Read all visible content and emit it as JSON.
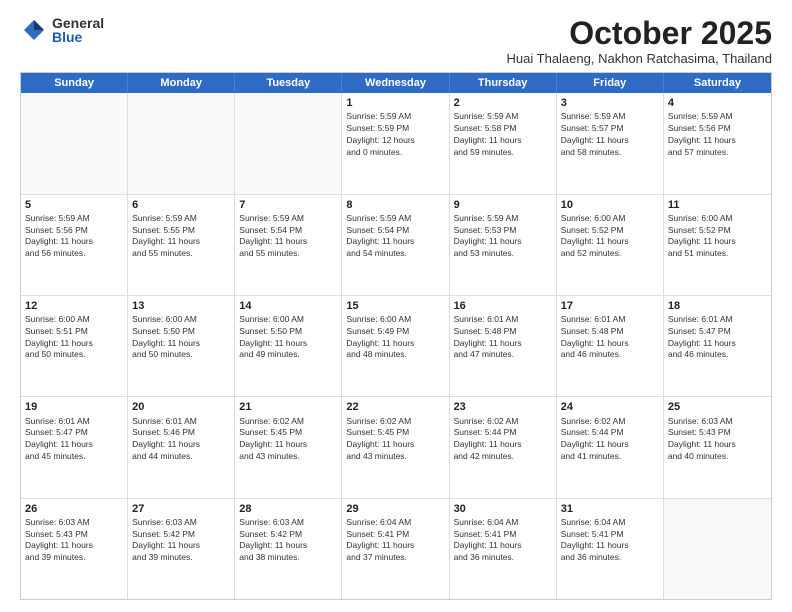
{
  "logo": {
    "general": "General",
    "blue": "Blue"
  },
  "header": {
    "month": "October 2025",
    "location": "Huai Thalaeng, Nakhon Ratchasima, Thailand"
  },
  "days": [
    "Sunday",
    "Monday",
    "Tuesday",
    "Wednesday",
    "Thursday",
    "Friday",
    "Saturday"
  ],
  "weeks": [
    [
      {
        "day": "",
        "text": ""
      },
      {
        "day": "",
        "text": ""
      },
      {
        "day": "",
        "text": ""
      },
      {
        "day": "1",
        "text": "Sunrise: 5:59 AM\nSunset: 5:59 PM\nDaylight: 12 hours\nand 0 minutes."
      },
      {
        "day": "2",
        "text": "Sunrise: 5:59 AM\nSunset: 5:58 PM\nDaylight: 11 hours\nand 59 minutes."
      },
      {
        "day": "3",
        "text": "Sunrise: 5:59 AM\nSunset: 5:57 PM\nDaylight: 11 hours\nand 58 minutes."
      },
      {
        "day": "4",
        "text": "Sunrise: 5:59 AM\nSunset: 5:56 PM\nDaylight: 11 hours\nand 57 minutes."
      }
    ],
    [
      {
        "day": "5",
        "text": "Sunrise: 5:59 AM\nSunset: 5:56 PM\nDaylight: 11 hours\nand 56 minutes."
      },
      {
        "day": "6",
        "text": "Sunrise: 5:59 AM\nSunset: 5:55 PM\nDaylight: 11 hours\nand 55 minutes."
      },
      {
        "day": "7",
        "text": "Sunrise: 5:59 AM\nSunset: 5:54 PM\nDaylight: 11 hours\nand 55 minutes."
      },
      {
        "day": "8",
        "text": "Sunrise: 5:59 AM\nSunset: 5:54 PM\nDaylight: 11 hours\nand 54 minutes."
      },
      {
        "day": "9",
        "text": "Sunrise: 5:59 AM\nSunset: 5:53 PM\nDaylight: 11 hours\nand 53 minutes."
      },
      {
        "day": "10",
        "text": "Sunrise: 6:00 AM\nSunset: 5:52 PM\nDaylight: 11 hours\nand 52 minutes."
      },
      {
        "day": "11",
        "text": "Sunrise: 6:00 AM\nSunset: 5:52 PM\nDaylight: 11 hours\nand 51 minutes."
      }
    ],
    [
      {
        "day": "12",
        "text": "Sunrise: 6:00 AM\nSunset: 5:51 PM\nDaylight: 11 hours\nand 50 minutes."
      },
      {
        "day": "13",
        "text": "Sunrise: 6:00 AM\nSunset: 5:50 PM\nDaylight: 11 hours\nand 50 minutes."
      },
      {
        "day": "14",
        "text": "Sunrise: 6:00 AM\nSunset: 5:50 PM\nDaylight: 11 hours\nand 49 minutes."
      },
      {
        "day": "15",
        "text": "Sunrise: 6:00 AM\nSunset: 5:49 PM\nDaylight: 11 hours\nand 48 minutes."
      },
      {
        "day": "16",
        "text": "Sunrise: 6:01 AM\nSunset: 5:48 PM\nDaylight: 11 hours\nand 47 minutes."
      },
      {
        "day": "17",
        "text": "Sunrise: 6:01 AM\nSunset: 5:48 PM\nDaylight: 11 hours\nand 46 minutes."
      },
      {
        "day": "18",
        "text": "Sunrise: 6:01 AM\nSunset: 5:47 PM\nDaylight: 11 hours\nand 46 minutes."
      }
    ],
    [
      {
        "day": "19",
        "text": "Sunrise: 6:01 AM\nSunset: 5:47 PM\nDaylight: 11 hours\nand 45 minutes."
      },
      {
        "day": "20",
        "text": "Sunrise: 6:01 AM\nSunset: 5:46 PM\nDaylight: 11 hours\nand 44 minutes."
      },
      {
        "day": "21",
        "text": "Sunrise: 6:02 AM\nSunset: 5:45 PM\nDaylight: 11 hours\nand 43 minutes."
      },
      {
        "day": "22",
        "text": "Sunrise: 6:02 AM\nSunset: 5:45 PM\nDaylight: 11 hours\nand 43 minutes."
      },
      {
        "day": "23",
        "text": "Sunrise: 6:02 AM\nSunset: 5:44 PM\nDaylight: 11 hours\nand 42 minutes."
      },
      {
        "day": "24",
        "text": "Sunrise: 6:02 AM\nSunset: 5:44 PM\nDaylight: 11 hours\nand 41 minutes."
      },
      {
        "day": "25",
        "text": "Sunrise: 6:03 AM\nSunset: 5:43 PM\nDaylight: 11 hours\nand 40 minutes."
      }
    ],
    [
      {
        "day": "26",
        "text": "Sunrise: 6:03 AM\nSunset: 5:43 PM\nDaylight: 11 hours\nand 39 minutes."
      },
      {
        "day": "27",
        "text": "Sunrise: 6:03 AM\nSunset: 5:42 PM\nDaylight: 11 hours\nand 39 minutes."
      },
      {
        "day": "28",
        "text": "Sunrise: 6:03 AM\nSunset: 5:42 PM\nDaylight: 11 hours\nand 38 minutes."
      },
      {
        "day": "29",
        "text": "Sunrise: 6:04 AM\nSunset: 5:41 PM\nDaylight: 11 hours\nand 37 minutes."
      },
      {
        "day": "30",
        "text": "Sunrise: 6:04 AM\nSunset: 5:41 PM\nDaylight: 11 hours\nand 36 minutes."
      },
      {
        "day": "31",
        "text": "Sunrise: 6:04 AM\nSunset: 5:41 PM\nDaylight: 11 hours\nand 36 minutes."
      },
      {
        "day": "",
        "text": ""
      }
    ]
  ]
}
